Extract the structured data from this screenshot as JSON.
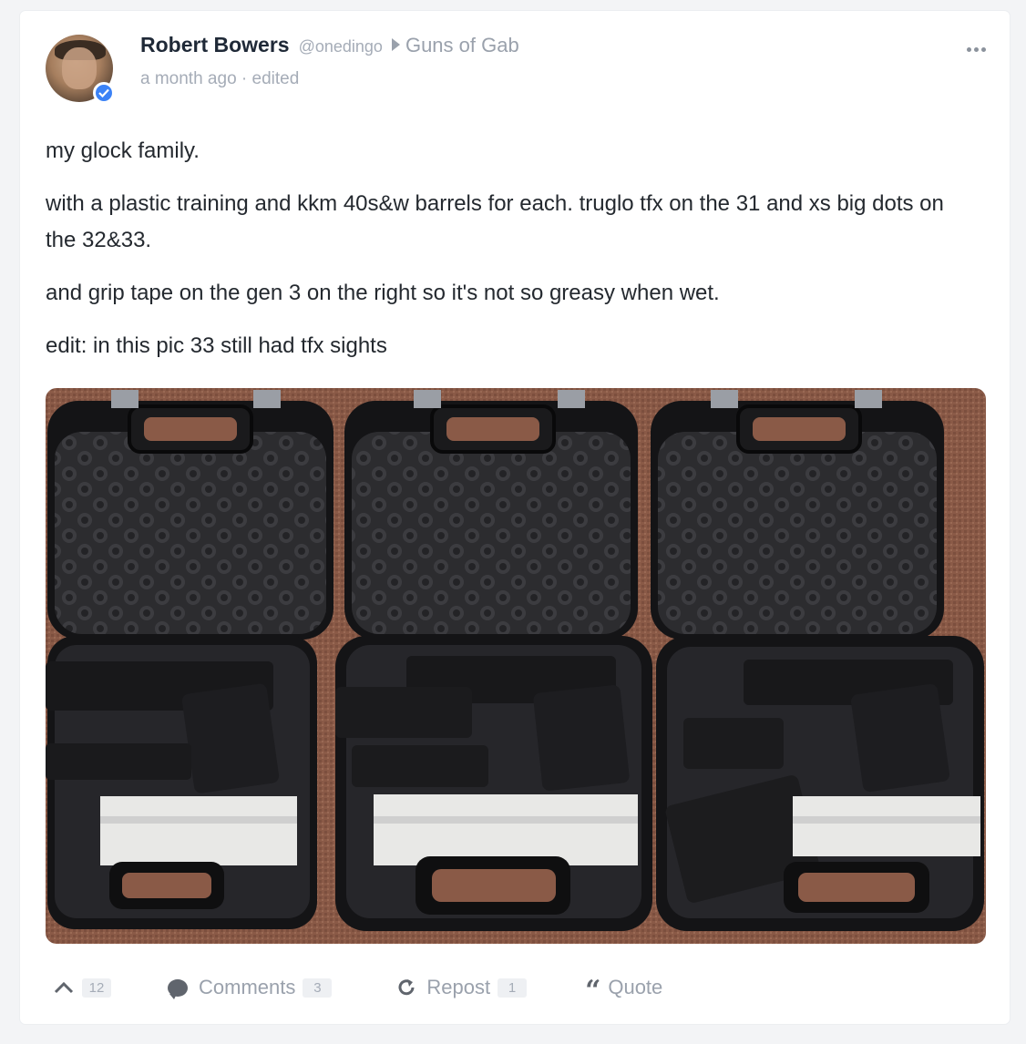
{
  "post": {
    "author_name": "Robert Bowers",
    "author_handle": "@onedingo",
    "group_name": "Guns of Gab",
    "timestamp": "a month ago",
    "meta_separator": "·",
    "edited_label": "edited",
    "verified": true,
    "paragraphs": [
      "my glock family.",
      "with a plastic training and kkm 40s&w barrels for each. truglo tfx on the 31 and xs big dots on the 32&33.",
      "and grip tape on the gen 3 on the right so it's not so greasy when wet.",
      "edit: in this pic 33 still had tfx sights"
    ]
  },
  "actions": {
    "upvote_count": "12",
    "comments_label": "Comments",
    "comments_count": "3",
    "repost_label": "Repost",
    "repost_count": "1",
    "quote_label": "Quote"
  },
  "icons": {
    "more": "more-horizontal-icon",
    "upvote": "chevron-up-icon",
    "comment": "comment-bubble-icon",
    "repost": "repost-icon",
    "quote": "quote-icon",
    "verified": "verified-badge-icon"
  },
  "colors": {
    "verified_blue": "#3b82f6",
    "text": "#24292f",
    "muted": "#9aa1ac",
    "carpet": "#8a5a47",
    "case": "#1f1f22"
  }
}
